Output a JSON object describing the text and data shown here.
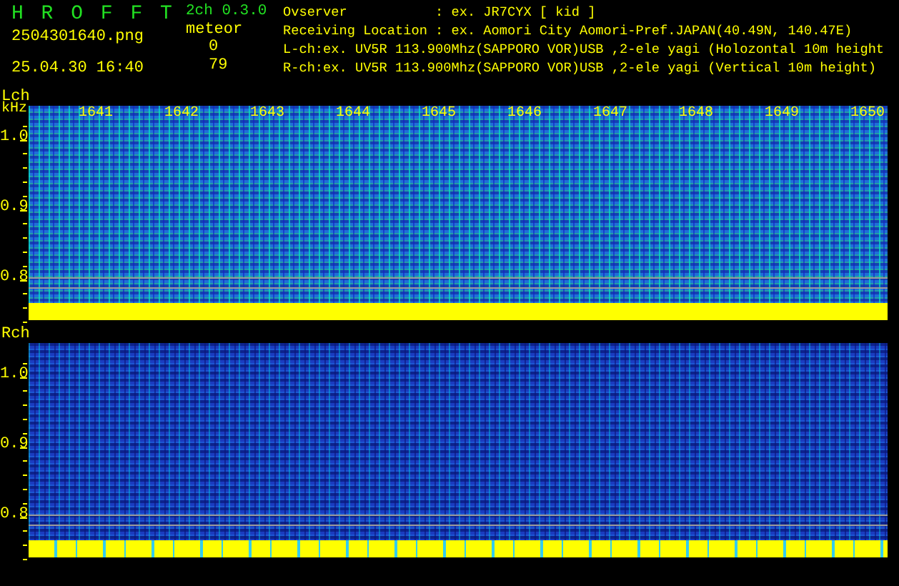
{
  "header": {
    "app_title": "H R O F F T",
    "version": "2ch 0.3.0",
    "filename": "2504301640.png",
    "datetime": "25.04.30 16:40",
    "meteor_label": "meteor",
    "meteor_counts": [
      "0",
      "79"
    ],
    "info_lines": [
      "Ovserver           : ex. JR7CYX [ kid ]",
      "Receiving Location : ex. Aomori City Aomori-Pref.JAPAN(40.49N, 140.47E)",
      "L-ch:ex. UV5R 113.900Mhz(SAPPORO VOR)USB ,2-ele yagi (Holozontal 10m height",
      "R-ch:ex. UV5R 113.900Mhz(SAPPORO VOR)USB ,2-ele yagi (Vertical 10m height)"
    ]
  },
  "channels": [
    {
      "label": "Lch",
      "unit": "kHz",
      "time_labels": [
        "1641",
        "1642",
        "1643",
        "1644",
        "1645",
        "1646",
        "1647",
        "1648",
        "1649",
        "1650"
      ],
      "y_labels": [
        "1.0",
        "0.9",
        "0.8"
      ]
    },
    {
      "label": "Rch",
      "y_labels": [
        "1.0",
        "0.9",
        "0.8"
      ]
    }
  ]
}
